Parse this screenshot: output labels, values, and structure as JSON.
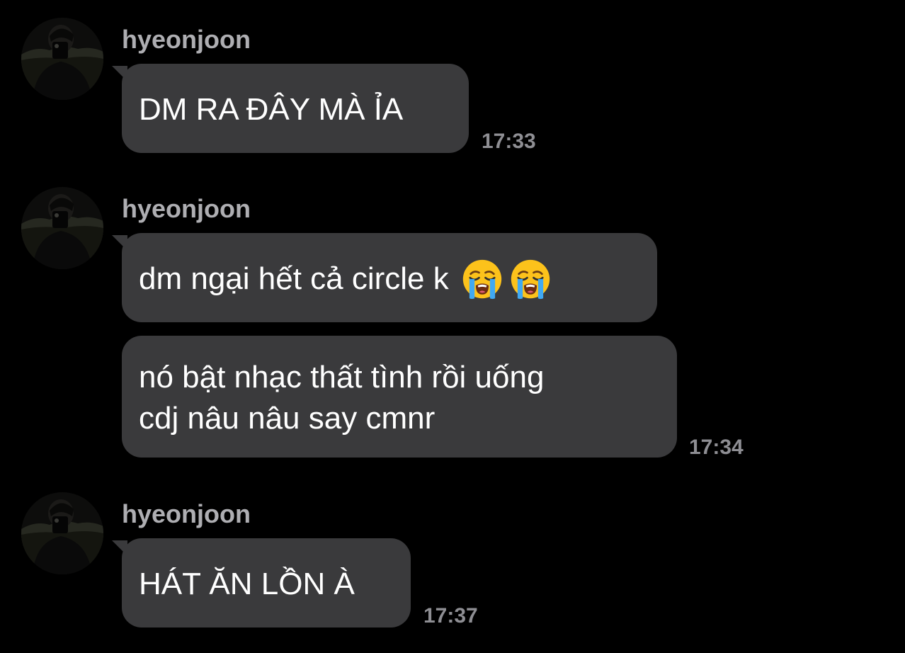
{
  "conversation": {
    "groups": [
      {
        "sender": "hyeonjoon",
        "avatar_icon": "profile-photo",
        "messages": [
          {
            "text": "DM RA ĐÂY MÀ ỈA"
          }
        ],
        "time": "17:33"
      },
      {
        "sender": "hyeonjoon",
        "avatar_icon": "profile-photo",
        "messages": [
          {
            "text": "dm ngại hết cả circle k",
            "emoji": [
              "loudly-crying-face",
              "loudly-crying-face"
            ]
          },
          {
            "line1": "nó bật nhạc thất tình rồi uống",
            "line2": "cdj nâu nâu say cmnr"
          }
        ],
        "time": "17:34"
      },
      {
        "sender": "hyeonjoon",
        "avatar_icon": "profile-photo",
        "messages": [
          {
            "text": "HÁT ĂN LỒN À"
          }
        ],
        "time": "17:37"
      }
    ]
  },
  "colors": {
    "background": "#000000",
    "bubble": "#3a3a3c",
    "sender_text": "#aeaeb2",
    "timestamp": "#8e8e93",
    "message_text": "#ffffff"
  }
}
